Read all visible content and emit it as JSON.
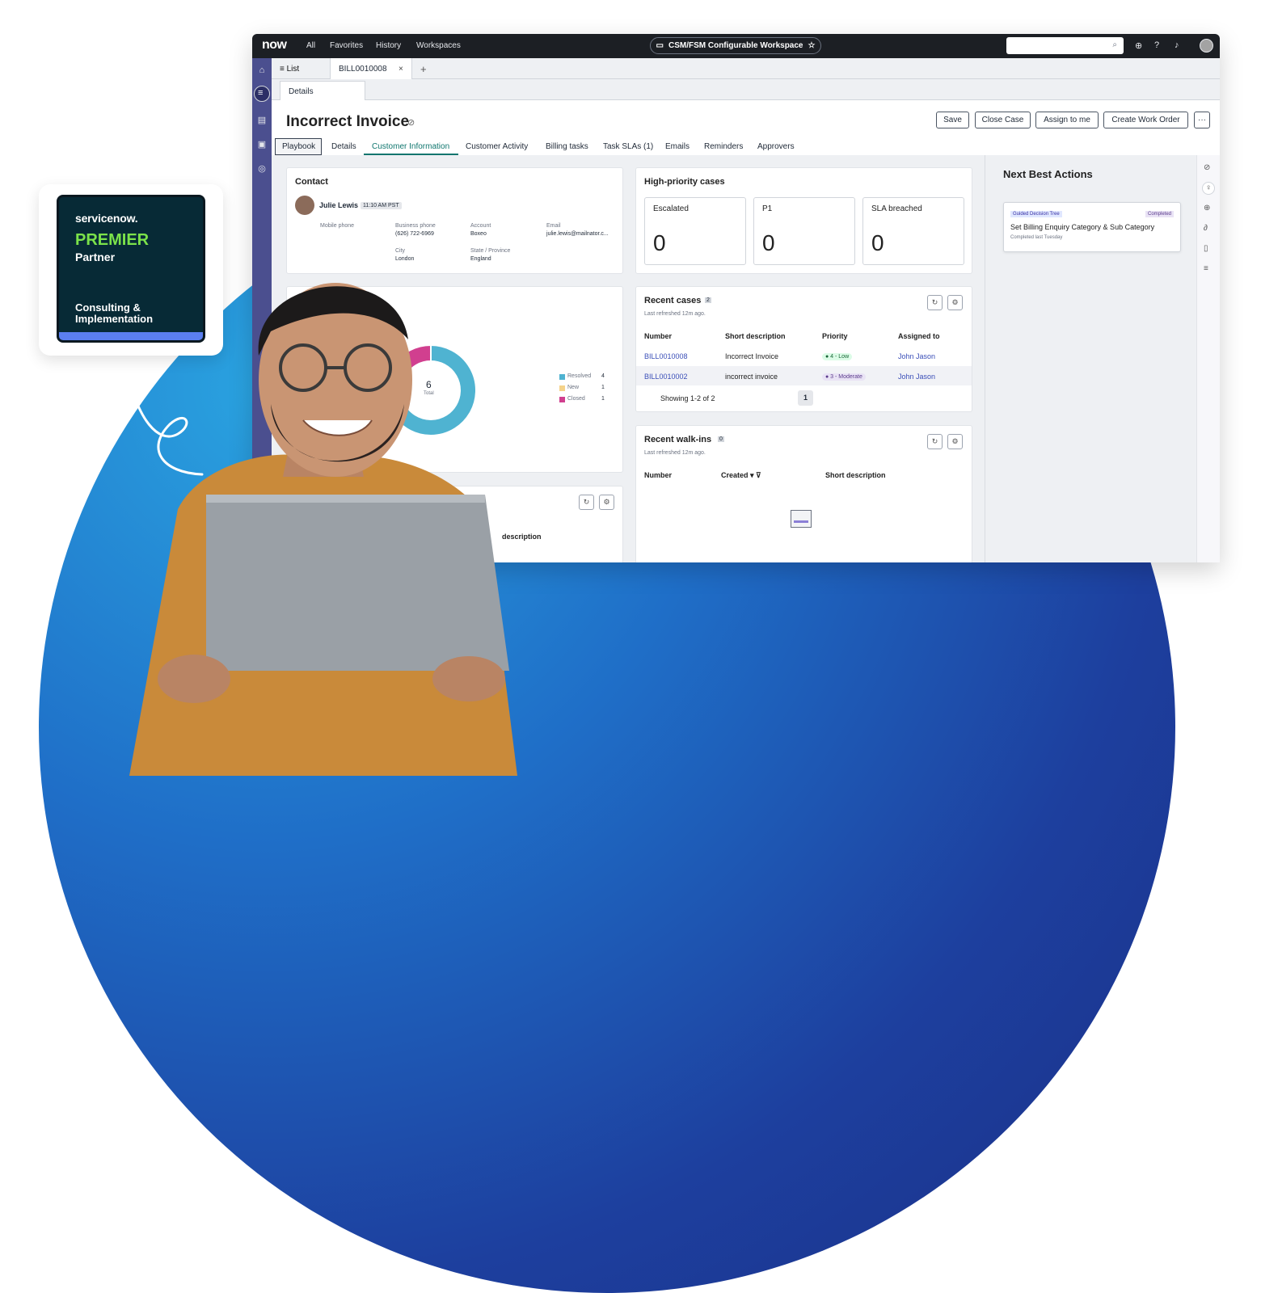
{
  "badge": {
    "brand": "servicenow.",
    "tier": "PREMIER",
    "tier_sub": "Partner",
    "specialty": "Consulting & Implementation"
  },
  "topbar": {
    "logo": "now",
    "nav": [
      "All",
      "Favorites",
      "History",
      "Workspaces"
    ],
    "workspace": "CSM/FSM Configurable Workspace",
    "search_placeholder": ""
  },
  "tabs": {
    "list_label": "≡ List",
    "record_tab": "BILL0010008",
    "close": "×",
    "add": "+",
    "sub_tab": "Details"
  },
  "record": {
    "title": "Incorrect Invoice",
    "buttons": [
      "Save",
      "Close Case",
      "Assign to me",
      "Create Work Order",
      "···"
    ],
    "tabs": [
      "Playbook",
      "Details",
      "Customer Information",
      "Customer Activity",
      "Billing tasks",
      "Task SLAs (1)",
      "Emails",
      "Reminders",
      "Approvers"
    ]
  },
  "contact": {
    "title": "Contact",
    "name": "Julie Lewis",
    "time": "11:10 AM PST",
    "fields": [
      {
        "label": "Mobile phone",
        "value": ""
      },
      {
        "label": "Business phone",
        "value": "(626) 722-6969"
      },
      {
        "label": "Account",
        "value": "Boxeo"
      },
      {
        "label": "Email",
        "value": "julie.lewis@mailnator.c..."
      },
      {
        "label": "City",
        "value": "London"
      },
      {
        "label": "State / Province",
        "value": "England"
      }
    ]
  },
  "high_priority": {
    "title": "High-priority cases",
    "stats": [
      {
        "label": "Escalated",
        "value": "0"
      },
      {
        "label": "P1",
        "value": "0"
      },
      {
        "label": "SLA breached",
        "value": "0"
      }
    ]
  },
  "donut": {
    "total": "6",
    "total_label": "Total",
    "legend": [
      {
        "label": "Resolved",
        "count": "4",
        "color": "#4fb3d1",
        "value": 4
      },
      {
        "label": "New",
        "count": "1",
        "color": "#f5d38a",
        "value": 1
      },
      {
        "label": "Closed",
        "count": "1",
        "color": "#d13f8f",
        "value": 1
      }
    ]
  },
  "recent_cases": {
    "title": "Recent cases",
    "count": "2",
    "refreshed": "Last refreshed 12m ago.",
    "columns": [
      "Number",
      "Short description",
      "Priority",
      "Assigned to"
    ],
    "rows": [
      {
        "number": "BILL0010008",
        "desc": "Incorrect Invoice",
        "priority": "● 4 - Low",
        "assigned": "John Jason"
      },
      {
        "number": "BILL0010002",
        "desc": "incorrect invoice",
        "priority": "● 3 - Moderate",
        "assigned": "John Jason"
      }
    ],
    "showing": "Showing 1-2 of 2",
    "page": "1"
  },
  "recent_walkins": {
    "title": "Recent walk-ins",
    "count": "0",
    "refreshed": "Last refreshed 12m ago.",
    "columns": [
      "Number",
      "Created ▾ ⊽",
      "Short description"
    ]
  },
  "lower_card": {
    "partial_label": "description"
  },
  "nba": {
    "title": "Next Best Actions",
    "tag": "Guided Decision Tree",
    "status": "Completed",
    "action": "Set Billing Enquiry Category & Sub Category",
    "when": "Completed last Tuesday"
  },
  "icons": {
    "rail": [
      "home-icon",
      "list-icon",
      "inbox-icon",
      "tray-icon",
      "headset-icon"
    ],
    "topbar": [
      "search-icon",
      "globe-icon",
      "help-icon",
      "bell-icon"
    ],
    "rightrail": [
      "tag-icon",
      "lightbulb-icon",
      "globe-icon",
      "paperclip-icon",
      "document-icon",
      "compose-icon"
    ]
  },
  "colors": {
    "accent": "#0f766e",
    "link": "#3b4fb8",
    "rail": "#4b4f8f",
    "brand_green": "#7be24a"
  }
}
